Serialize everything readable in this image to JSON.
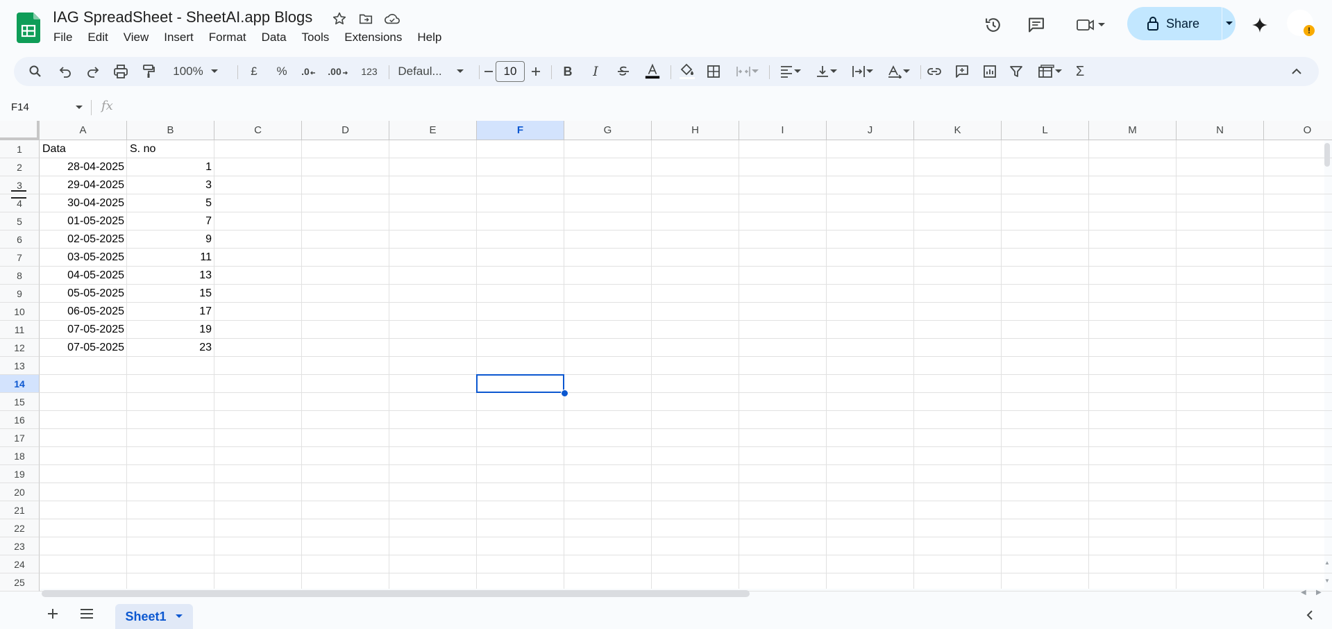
{
  "app": {
    "doc_title": "IAG SpreadSheet - SheetAI.app Blogs",
    "menu": [
      "File",
      "Edit",
      "View",
      "Insert",
      "Format",
      "Data",
      "Tools",
      "Extensions",
      "Help"
    ],
    "share_label": "Share",
    "brand_color": "#0f9d58",
    "accent_color": "#0b57d0"
  },
  "toolbar": {
    "zoom": "100%",
    "currency": "£",
    "percent": "%",
    "dec_decrease": ".0",
    "dec_increase": ".00",
    "number_format": "123",
    "font_name": "Defaul...",
    "font_size": "10",
    "bold": "B",
    "italic": "I",
    "sum": "Σ"
  },
  "formula_bar": {
    "name_box": "F14",
    "fx_label": "fx",
    "value": ""
  },
  "sheet": {
    "columns": [
      "A",
      "B",
      "C",
      "D",
      "E",
      "F",
      "G",
      "H",
      "I",
      "J",
      "K",
      "L",
      "M",
      "N",
      "O"
    ],
    "selected_column": "F",
    "rows": [
      "1",
      "2",
      "3",
      "4",
      "5",
      "6",
      "7",
      "8",
      "9",
      "10",
      "11",
      "12",
      "13",
      "14",
      "15",
      "16",
      "17",
      "18",
      "19",
      "20",
      "21",
      "22",
      "23",
      "24",
      "25"
    ],
    "selected_row": "14",
    "header": {
      "a": "Data",
      "b": "S. no"
    },
    "data": [
      {
        "date": "28-04-2025",
        "sno": "1"
      },
      {
        "date": "29-04-2025",
        "sno": "3"
      },
      {
        "date": "30-04-2025",
        "sno": "5"
      },
      {
        "date": "01-05-2025",
        "sno": "7"
      },
      {
        "date": "02-05-2025",
        "sno": "9"
      },
      {
        "date": "03-05-2025",
        "sno": "11"
      },
      {
        "date": "04-05-2025",
        "sno": "13"
      },
      {
        "date": "05-05-2025",
        "sno": "15"
      },
      {
        "date": "06-05-2025",
        "sno": "17"
      },
      {
        "date": "07-05-2025",
        "sno": "19"
      },
      {
        "date": "07-05-2025",
        "sno": "23"
      }
    ],
    "active_cell": "F14"
  },
  "tabs": {
    "sheet_name": "Sheet1"
  }
}
